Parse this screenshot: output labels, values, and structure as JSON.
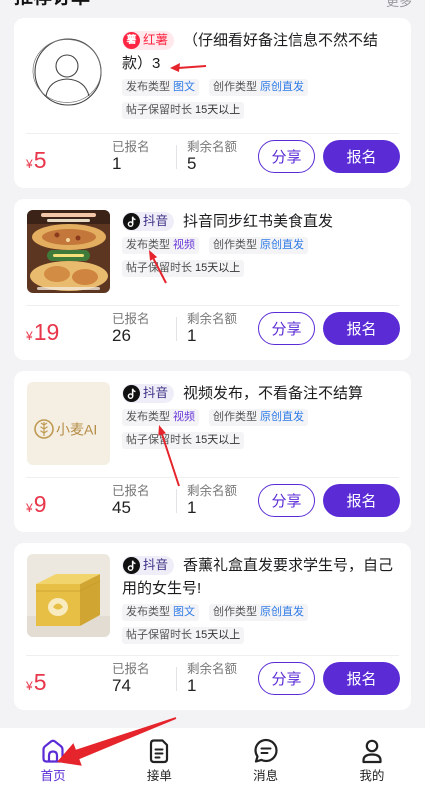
{
  "colors": {
    "accent": "#5b2cd6",
    "price": "#e8364a",
    "tag_blue": "#2f7be6",
    "tag_purple": "#6a3ad8",
    "background": "#f3f3f5",
    "annotation": "#e5242c"
  },
  "header": {
    "title": "推荐订单",
    "more": "更多"
  },
  "orders": [
    {
      "thumbnail": "avatar-placeholder-image",
      "platform": {
        "name": "红薯",
        "icon_text": "薯",
        "icon": "xiaohongshu-icon"
      },
      "title": "（仔细看好备注信息不然不结款）3",
      "publish_type_label": "发布类型",
      "publish_type": "图文",
      "create_type_label": "创作类型",
      "create_type": "原创直发",
      "retention_label": "帖子保留时长",
      "retention": "15天以上",
      "currency": "¥",
      "price": "5",
      "signed_label": "已报名",
      "signed": "1",
      "remaining_label": "剩余名额",
      "remaining": "5",
      "share_label": "分享",
      "apply_label": "报名"
    },
    {
      "thumbnail": "food-photo-image",
      "platform": {
        "name": "抖音",
        "icon": "douyin-icon"
      },
      "title": "抖音同步红书美食直发",
      "publish_type_label": "发布类型",
      "publish_type": "视频",
      "create_type_label": "创作类型",
      "create_type": "原创直发",
      "retention_label": "帖子保留时长",
      "retention": "15天以上",
      "currency": "¥",
      "price": "19",
      "signed_label": "已报名",
      "signed": "26",
      "remaining_label": "剩余名额",
      "remaining": "1",
      "share_label": "分享",
      "apply_label": "报名"
    },
    {
      "thumbnail": "xiaomai-ai-logo-image",
      "thumbnail_text": "小麦AI",
      "platform": {
        "name": "抖音",
        "icon": "douyin-icon"
      },
      "title": "视频发布，不看备注不结算",
      "publish_type_label": "发布类型",
      "publish_type": "视频",
      "create_type_label": "创作类型",
      "create_type": "原创直发",
      "retention_label": "帖子保留时长",
      "retention": "15天以上",
      "currency": "¥",
      "price": "9",
      "signed_label": "已报名",
      "signed": "45",
      "remaining_label": "剩余名额",
      "remaining": "1",
      "share_label": "分享",
      "apply_label": "报名"
    },
    {
      "thumbnail": "gift-box-photo-image",
      "platform": {
        "name": "抖音",
        "icon": "douyin-icon"
      },
      "title": "香薰礼盒直发要求学生号，自己用的女生号!",
      "publish_type_label": "发布类型",
      "publish_type": "图文",
      "create_type_label": "创作类型",
      "create_type": "原创直发",
      "retention_label": "帖子保留时长",
      "retention": "15天以上",
      "currency": "¥",
      "price": "5",
      "signed_label": "已报名",
      "signed": "74",
      "remaining_label": "剩余名额",
      "remaining": "1",
      "share_label": "分享",
      "apply_label": "报名"
    }
  ],
  "nav": [
    {
      "label": "首页",
      "icon": "home-icon",
      "active": true
    },
    {
      "label": "接单",
      "icon": "order-document-icon",
      "active": false
    },
    {
      "label": "消息",
      "icon": "message-bubble-icon",
      "active": false
    },
    {
      "label": "我的",
      "icon": "profile-icon",
      "active": false
    }
  ]
}
